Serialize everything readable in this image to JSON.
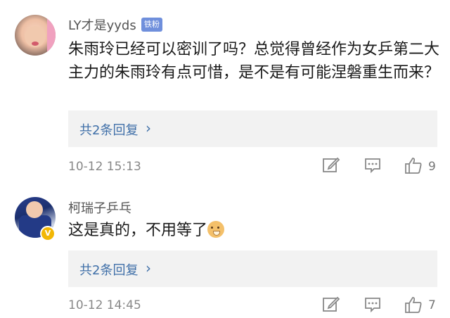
{
  "comments": [
    {
      "username": "LY才是yyds",
      "badge": "铁粉",
      "text": "朱雨玲已经可以密训了吗？总觉得曾经作为女乒第二大主力的朱雨玲有点可惜，是不是有可能涅磐重生而来？",
      "replies_label": "共2条回复",
      "timestamp": "10-12 15:13",
      "likes": "9"
    },
    {
      "username": "柯瑞子乒乓",
      "verified": "V",
      "text": "这是真的，不用等了",
      "emoji": "dog-face-emoji",
      "replies_label": "共2条回复",
      "timestamp": "10-12 14:45",
      "likes": "7"
    }
  ],
  "icons": {
    "chevron": "chevron-right-icon",
    "edit": "edit-icon",
    "reply": "comment-icon",
    "like": "thumbs-up-icon"
  },
  "colors": {
    "link": "#3f6fa8",
    "badge": "#6f8fdc",
    "verified": "#f2b705"
  }
}
